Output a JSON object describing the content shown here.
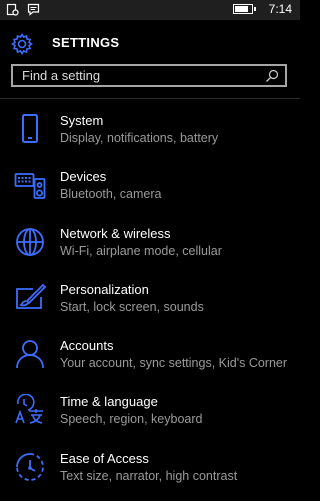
{
  "status_bar": {
    "time": "7:14",
    "battery_level": 0.8
  },
  "header": {
    "title": "SETTINGS",
    "icon": "gear-icon"
  },
  "search": {
    "placeholder": "Find a setting",
    "icon": "search-icon"
  },
  "accent_color": "#3d6dff",
  "items": [
    {
      "label": "System",
      "sub": "Display, notifications, battery",
      "icon": "phone-icon"
    },
    {
      "label": "Devices",
      "sub": "Bluetooth, camera",
      "icon": "keyboard-speaker-icon"
    },
    {
      "label": "Network & wireless",
      "sub": "Wi-Fi, airplane mode, cellular",
      "icon": "globe-icon"
    },
    {
      "label": "Personalization",
      "sub": "Start, lock screen, sounds",
      "icon": "paintbrush-icon"
    },
    {
      "label": "Accounts",
      "sub": "Your account, sync settings, Kid's Corner",
      "icon": "person-icon"
    },
    {
      "label": "Time & language",
      "sub": "Speech, region, keyboard",
      "icon": "language-icon"
    },
    {
      "label": "Ease of Access",
      "sub": "Text size, narrator, high contrast",
      "icon": "clock-accessibility-icon"
    }
  ]
}
